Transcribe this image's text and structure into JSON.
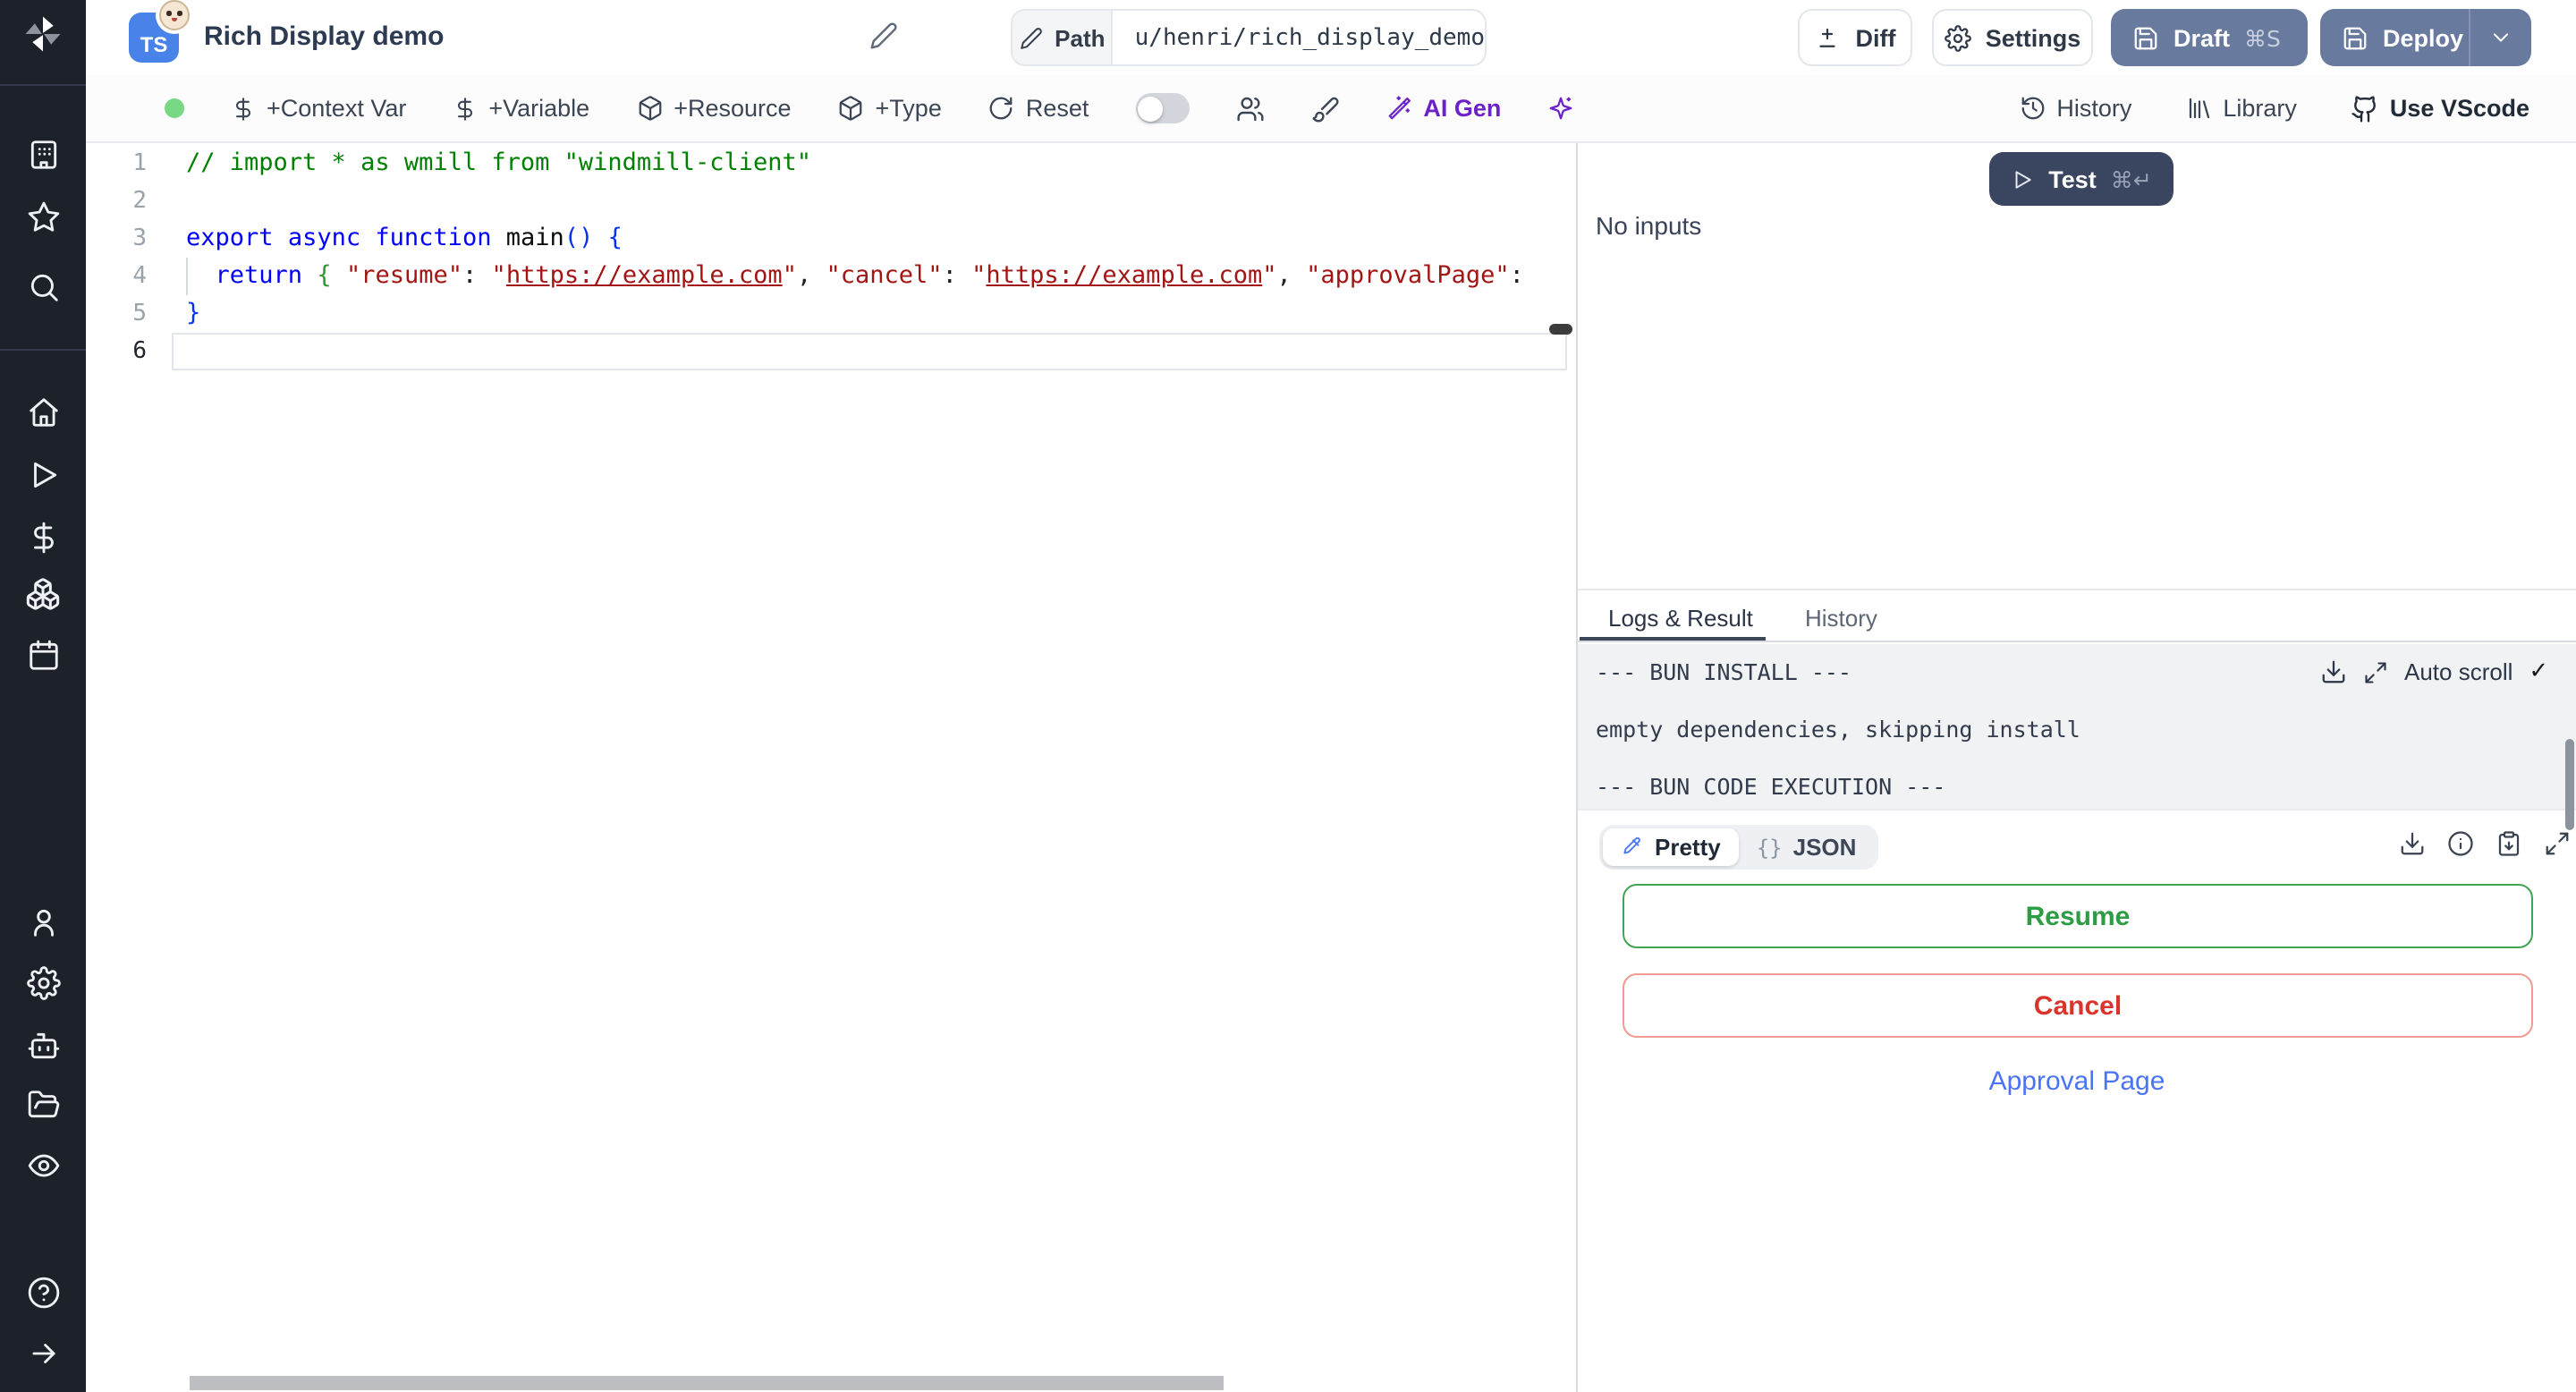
{
  "colors": {
    "brand_blue": "#4982e8",
    "slate_button": "#687a9e",
    "navy_button": "#3a4560",
    "success_green": "#2e9c44",
    "danger_red": "#da352c",
    "link_blue": "#4a74f5",
    "ai_violet": "#6d22c9",
    "run_dot_green": "#77d983",
    "sidebar_bg": "#1d212a"
  },
  "sidebar": {
    "icons": [
      "windmill-logo",
      "workspace",
      "favorites",
      "search",
      "home",
      "runs",
      "variables",
      "resources",
      "schedules",
      "user",
      "settings",
      "workers",
      "folders",
      "audit",
      "help",
      "expand"
    ]
  },
  "header": {
    "badge": "TS",
    "title": "Rich Display demo",
    "path_label": "Path",
    "path_value": "u/henri/rich_display_demo",
    "diff_label": "Diff",
    "settings_label": "Settings",
    "draft_label": "Draft",
    "draft_shortcut": "⌘S",
    "deploy_label": "Deploy"
  },
  "toolbar": {
    "context_var": "+Context Var",
    "variable": "+Variable",
    "resource": "+Resource",
    "type": "+Type",
    "reset": "Reset",
    "ai_gen": "AI Gen",
    "history": "History",
    "library": "Library",
    "use_vscode": "Use VScode"
  },
  "editor": {
    "language": "typescript",
    "active_line": 6,
    "lines": [
      {
        "n": 1,
        "tokens": [
          {
            "t": "// import * as wmill from \"windmill-client\"",
            "c": "cmt"
          }
        ]
      },
      {
        "n": 2,
        "tokens": []
      },
      {
        "n": 3,
        "tokens": [
          {
            "t": "export",
            "c": "kw"
          },
          {
            "t": " ",
            "c": "pl"
          },
          {
            "t": "async",
            "c": "kw"
          },
          {
            "t": " ",
            "c": "pl"
          },
          {
            "t": "function",
            "c": "kw"
          },
          {
            "t": " ",
            "c": "pl"
          },
          {
            "t": "main",
            "c": "fn"
          },
          {
            "t": "(",
            "c": "b1"
          },
          {
            "t": ")",
            "c": "b1"
          },
          {
            "t": " ",
            "c": "pl"
          },
          {
            "t": "{",
            "c": "b1"
          }
        ]
      },
      {
        "n": 4,
        "tokens": [
          {
            "t": "  ",
            "c": "pl"
          },
          {
            "t": "return",
            "c": "kw"
          },
          {
            "t": " ",
            "c": "pl"
          },
          {
            "t": "{",
            "c": "b2"
          },
          {
            "t": " ",
            "c": "pl"
          },
          {
            "t": "\"resume\"",
            "c": "str"
          },
          {
            "t": ": ",
            "c": "pl"
          },
          {
            "t": "\"",
            "c": "str"
          },
          {
            "t": "https://example.com",
            "c": "lnk"
          },
          {
            "t": "\"",
            "c": "str"
          },
          {
            "t": ", ",
            "c": "pl"
          },
          {
            "t": "\"cancel\"",
            "c": "str"
          },
          {
            "t": ": ",
            "c": "pl"
          },
          {
            "t": "\"",
            "c": "str"
          },
          {
            "t": "https://example.com",
            "c": "lnk"
          },
          {
            "t": "\"",
            "c": "str"
          },
          {
            "t": ", ",
            "c": "pl"
          },
          {
            "t": "\"approvalPage\"",
            "c": "str"
          },
          {
            "t": ":",
            "c": "pl"
          }
        ]
      },
      {
        "n": 5,
        "tokens": [
          {
            "t": "}",
            "c": "b1"
          }
        ]
      },
      {
        "n": 6,
        "tokens": []
      }
    ]
  },
  "run_panel": {
    "test_label": "Test",
    "test_shortcut": "⌘↵",
    "no_inputs": "No inputs"
  },
  "tabs": {
    "logs_result": "Logs & Result",
    "history": "History"
  },
  "logs": {
    "lines": [
      "--- BUN INSTALL ---",
      "empty dependencies, skipping install",
      "--- BUN CODE EXECUTION ---"
    ],
    "auto_scroll_label": "Auto scroll",
    "auto_scroll_check": "✓"
  },
  "result": {
    "pretty_label": "Pretty",
    "json_braces": "{}",
    "json_label": "JSON",
    "buttons": {
      "resume": "Resume",
      "cancel": "Cancel",
      "approval_page": "Approval Page"
    }
  }
}
